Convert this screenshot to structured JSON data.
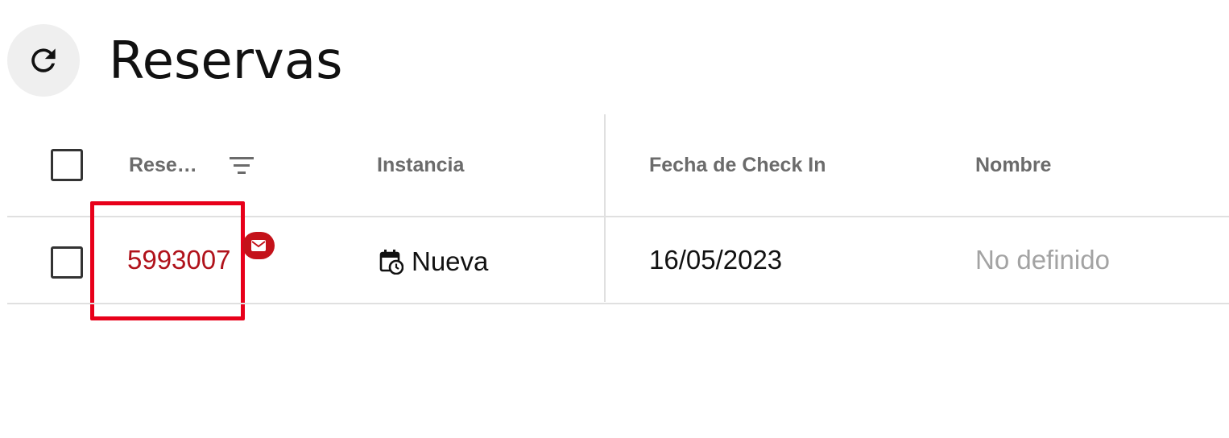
{
  "header": {
    "title": "Reservas",
    "refresh_icon": "refresh-icon"
  },
  "table": {
    "columns": [
      {
        "key": "reserva",
        "label": "Rese…",
        "has_filter": true
      },
      {
        "key": "instancia",
        "label": "Instancia"
      },
      {
        "key": "fecha_check_in",
        "label": "Fecha de Check In"
      },
      {
        "key": "nombre",
        "label": "Nombre"
      }
    ],
    "rows": [
      {
        "reserva": "5993007",
        "has_mail_badge": true,
        "instancia_icon": "calendar-clock-icon",
        "instancia": "Nueva",
        "fecha_check_in": "16/05/2023",
        "nombre": "No definido"
      }
    ]
  },
  "colors": {
    "accent": "#b0121b",
    "highlight": "#e8001a",
    "badge": "#c4121a",
    "muted": "#a3a3a3",
    "header_text": "#6b6b6b"
  }
}
